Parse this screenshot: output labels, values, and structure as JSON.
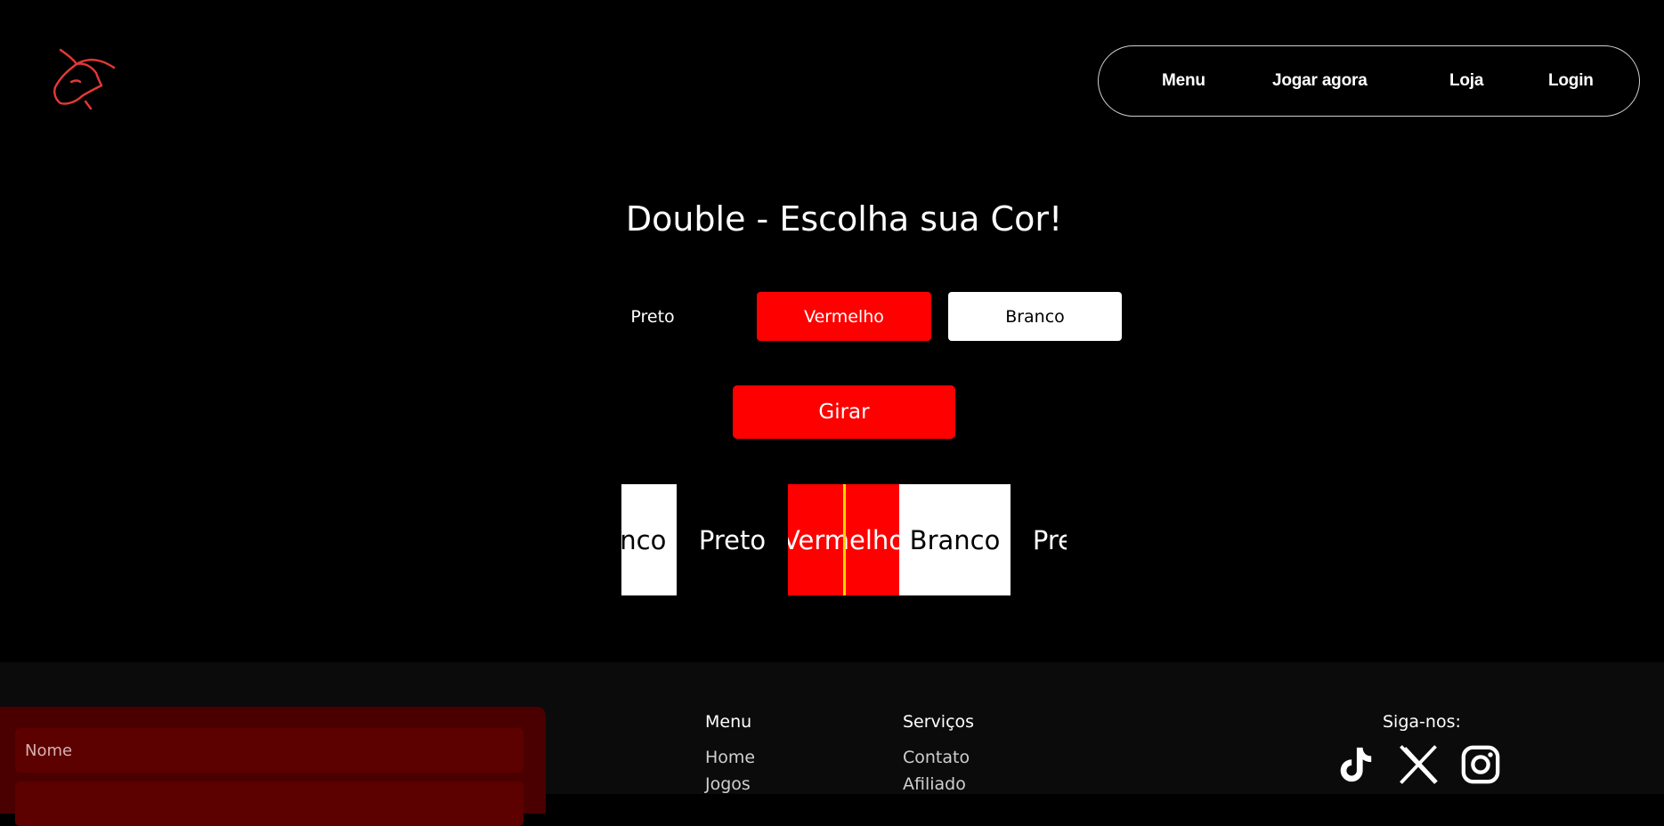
{
  "header": {
    "logo_name": "bull-logo",
    "nav": [
      {
        "label": "Menu"
      },
      {
        "label": "Jogar agora"
      },
      {
        "label": "Loja"
      },
      {
        "label": "Login"
      }
    ]
  },
  "game": {
    "title": "Double - Escolha sua Cor!",
    "choices": [
      {
        "label": "Preto",
        "color": "#000000"
      },
      {
        "label": "Vermelho",
        "color": "#ff0000"
      },
      {
        "label": "Branco",
        "color": "#ffffff"
      }
    ],
    "spin_label": "Girar",
    "roulette": [
      {
        "label": "Branco",
        "color": "#ffffff"
      },
      {
        "label": "Preto",
        "color": "#000000"
      },
      {
        "label": "Vermelho",
        "color": "#ff0000"
      },
      {
        "label": "Branco",
        "color": "#ffffff"
      },
      {
        "label": "Preto",
        "color": "#000000"
      }
    ],
    "pointer_color": "#ffd400"
  },
  "footer": {
    "form": {
      "name_placeholder": "Nome",
      "panel_color": "#4a0000",
      "field_color": "#5c0000"
    },
    "menu": {
      "title": "Menu",
      "links": [
        "Home",
        "Jogos"
      ]
    },
    "services": {
      "title": "Serviços",
      "links": [
        "Contato",
        "Afiliado"
      ]
    },
    "social": {
      "title": "Siga-nos:",
      "icons": [
        "tiktok-icon",
        "x-icon",
        "instagram-icon"
      ]
    }
  },
  "colors": {
    "accent": "#ff0000",
    "logo": "#e53935"
  }
}
